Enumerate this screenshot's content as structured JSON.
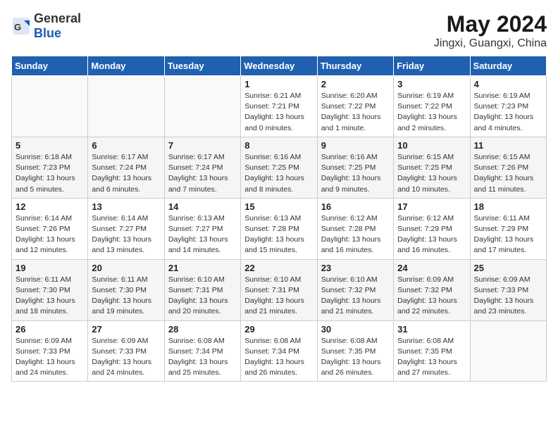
{
  "logo": {
    "general": "General",
    "blue": "Blue"
  },
  "title": "May 2024",
  "subtitle": "Jingxi, Guangxi, China",
  "days_of_week": [
    "Sunday",
    "Monday",
    "Tuesday",
    "Wednesday",
    "Thursday",
    "Friday",
    "Saturday"
  ],
  "weeks": [
    [
      {
        "day": "",
        "info": ""
      },
      {
        "day": "",
        "info": ""
      },
      {
        "day": "",
        "info": ""
      },
      {
        "day": "1",
        "info": "Sunrise: 6:21 AM\nSunset: 7:21 PM\nDaylight: 13 hours\nand 0 minutes."
      },
      {
        "day": "2",
        "info": "Sunrise: 6:20 AM\nSunset: 7:22 PM\nDaylight: 13 hours\nand 1 minute."
      },
      {
        "day": "3",
        "info": "Sunrise: 6:19 AM\nSunset: 7:22 PM\nDaylight: 13 hours\nand 2 minutes."
      },
      {
        "day": "4",
        "info": "Sunrise: 6:19 AM\nSunset: 7:23 PM\nDaylight: 13 hours\nand 4 minutes."
      }
    ],
    [
      {
        "day": "5",
        "info": "Sunrise: 6:18 AM\nSunset: 7:23 PM\nDaylight: 13 hours\nand 5 minutes."
      },
      {
        "day": "6",
        "info": "Sunrise: 6:17 AM\nSunset: 7:24 PM\nDaylight: 13 hours\nand 6 minutes."
      },
      {
        "day": "7",
        "info": "Sunrise: 6:17 AM\nSunset: 7:24 PM\nDaylight: 13 hours\nand 7 minutes."
      },
      {
        "day": "8",
        "info": "Sunrise: 6:16 AM\nSunset: 7:25 PM\nDaylight: 13 hours\nand 8 minutes."
      },
      {
        "day": "9",
        "info": "Sunrise: 6:16 AM\nSunset: 7:25 PM\nDaylight: 13 hours\nand 9 minutes."
      },
      {
        "day": "10",
        "info": "Sunrise: 6:15 AM\nSunset: 7:25 PM\nDaylight: 13 hours\nand 10 minutes."
      },
      {
        "day": "11",
        "info": "Sunrise: 6:15 AM\nSunset: 7:26 PM\nDaylight: 13 hours\nand 11 minutes."
      }
    ],
    [
      {
        "day": "12",
        "info": "Sunrise: 6:14 AM\nSunset: 7:26 PM\nDaylight: 13 hours\nand 12 minutes."
      },
      {
        "day": "13",
        "info": "Sunrise: 6:14 AM\nSunset: 7:27 PM\nDaylight: 13 hours\nand 13 minutes."
      },
      {
        "day": "14",
        "info": "Sunrise: 6:13 AM\nSunset: 7:27 PM\nDaylight: 13 hours\nand 14 minutes."
      },
      {
        "day": "15",
        "info": "Sunrise: 6:13 AM\nSunset: 7:28 PM\nDaylight: 13 hours\nand 15 minutes."
      },
      {
        "day": "16",
        "info": "Sunrise: 6:12 AM\nSunset: 7:28 PM\nDaylight: 13 hours\nand 16 minutes."
      },
      {
        "day": "17",
        "info": "Sunrise: 6:12 AM\nSunset: 7:29 PM\nDaylight: 13 hours\nand 16 minutes."
      },
      {
        "day": "18",
        "info": "Sunrise: 6:11 AM\nSunset: 7:29 PM\nDaylight: 13 hours\nand 17 minutes."
      }
    ],
    [
      {
        "day": "19",
        "info": "Sunrise: 6:11 AM\nSunset: 7:30 PM\nDaylight: 13 hours\nand 18 minutes."
      },
      {
        "day": "20",
        "info": "Sunrise: 6:11 AM\nSunset: 7:30 PM\nDaylight: 13 hours\nand 19 minutes."
      },
      {
        "day": "21",
        "info": "Sunrise: 6:10 AM\nSunset: 7:31 PM\nDaylight: 13 hours\nand 20 minutes."
      },
      {
        "day": "22",
        "info": "Sunrise: 6:10 AM\nSunset: 7:31 PM\nDaylight: 13 hours\nand 21 minutes."
      },
      {
        "day": "23",
        "info": "Sunrise: 6:10 AM\nSunset: 7:32 PM\nDaylight: 13 hours\nand 21 minutes."
      },
      {
        "day": "24",
        "info": "Sunrise: 6:09 AM\nSunset: 7:32 PM\nDaylight: 13 hours\nand 22 minutes."
      },
      {
        "day": "25",
        "info": "Sunrise: 6:09 AM\nSunset: 7:33 PM\nDaylight: 13 hours\nand 23 minutes."
      }
    ],
    [
      {
        "day": "26",
        "info": "Sunrise: 6:09 AM\nSunset: 7:33 PM\nDaylight: 13 hours\nand 24 minutes."
      },
      {
        "day": "27",
        "info": "Sunrise: 6:09 AM\nSunset: 7:33 PM\nDaylight: 13 hours\nand 24 minutes."
      },
      {
        "day": "28",
        "info": "Sunrise: 6:08 AM\nSunset: 7:34 PM\nDaylight: 13 hours\nand 25 minutes."
      },
      {
        "day": "29",
        "info": "Sunrise: 6:08 AM\nSunset: 7:34 PM\nDaylight: 13 hours\nand 26 minutes."
      },
      {
        "day": "30",
        "info": "Sunrise: 6:08 AM\nSunset: 7:35 PM\nDaylight: 13 hours\nand 26 minutes."
      },
      {
        "day": "31",
        "info": "Sunrise: 6:08 AM\nSunset: 7:35 PM\nDaylight: 13 hours\nand 27 minutes."
      },
      {
        "day": "",
        "info": ""
      }
    ]
  ]
}
